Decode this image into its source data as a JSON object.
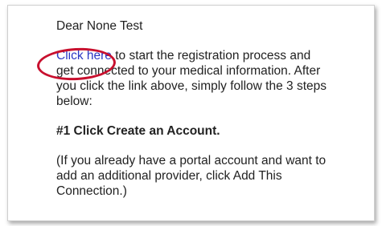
{
  "email": {
    "greeting": "Dear None Test",
    "link_text": "Click here",
    "para1_rest": " to start the registration process and get connected to your medical information. After you click the link above, simply follow the 3 steps below:",
    "step1": "#1 Click Create an Account.",
    "note": "(If you already have a portal account and want to add an additional provider, click Add This Connection.)"
  },
  "annotation": {
    "color": "#c8102e"
  },
  "colors": {
    "link": "#2a36c4",
    "text": "#222222"
  }
}
